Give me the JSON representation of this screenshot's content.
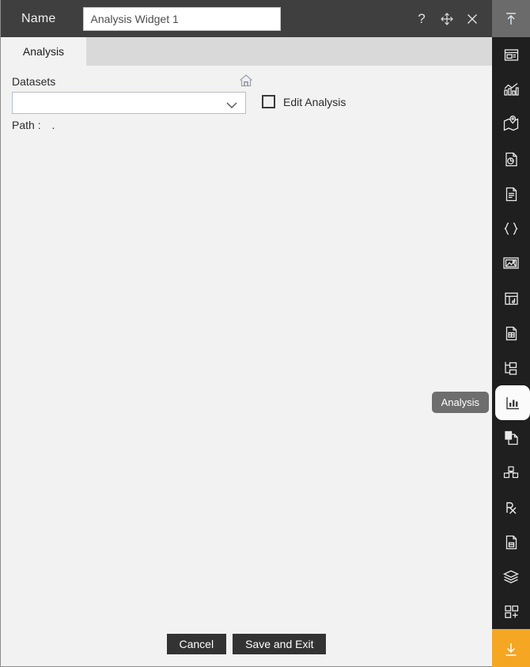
{
  "window": {
    "title_label": "Name",
    "name_value": "Analysis Widget 1",
    "name_placeholder": "Name",
    "actions": [
      {
        "name": "help-icon",
        "label": "?"
      },
      {
        "name": "move-icon",
        "label": "Move"
      },
      {
        "name": "close-icon",
        "label": "Close"
      }
    ]
  },
  "tabs": [
    {
      "label": "Analysis",
      "active": true
    }
  ],
  "form": {
    "datasets_label": "Datasets",
    "datasets_value": "",
    "datasets_placeholder": "",
    "home_icon": "home-icon",
    "edit_analysis_label": "Edit Analysis",
    "edit_analysis_checked": false,
    "path_label": "Path :",
    "path_value": "."
  },
  "footer": {
    "cancel_label": "Cancel",
    "save_label": "Save and Exit"
  },
  "tooltip": {
    "text": "Analysis"
  },
  "sidebar": {
    "items": [
      {
        "name": "collapse-up-icon",
        "title": "Collapse"
      },
      {
        "name": "panel-layout-icon",
        "title": "Layout"
      },
      {
        "name": "bar-line-chart-icon",
        "title": "Chart"
      },
      {
        "name": "map-pin-icon",
        "title": "Map"
      },
      {
        "name": "pie-document-icon",
        "title": "Report"
      },
      {
        "name": "text-document-icon",
        "title": "Document"
      },
      {
        "name": "curly-braces-icon",
        "title": "JSON"
      },
      {
        "name": "image-gallery-icon",
        "title": "Image"
      },
      {
        "name": "frame-note-icon",
        "title": "Frame"
      },
      {
        "name": "spreadsheet-document-icon",
        "title": "Spreadsheet"
      },
      {
        "name": "tree-hierarchy-icon",
        "title": "Tree"
      },
      {
        "name": "analysis-chart-icon",
        "title": "Analysis"
      },
      {
        "name": "copy-document-icon",
        "title": "Copy"
      },
      {
        "name": "cubes-icon",
        "title": "Blocks"
      },
      {
        "name": "prescription-rx-icon",
        "title": "Rx"
      },
      {
        "name": "save-document-icon",
        "title": "Save"
      },
      {
        "name": "layers-stack-icon",
        "title": "Layers"
      },
      {
        "name": "add-widget-icon",
        "title": "Add"
      },
      {
        "name": "download-icon",
        "title": "Download"
      }
    ]
  },
  "colors": {
    "titlebar": "#3f3f3f",
    "panel": "#f2f2f2",
    "tabstrip": "#d9d9d9",
    "sidebar": "#1f1f1f",
    "accent_orange": "#f5a623",
    "button_dark": "#333333"
  }
}
